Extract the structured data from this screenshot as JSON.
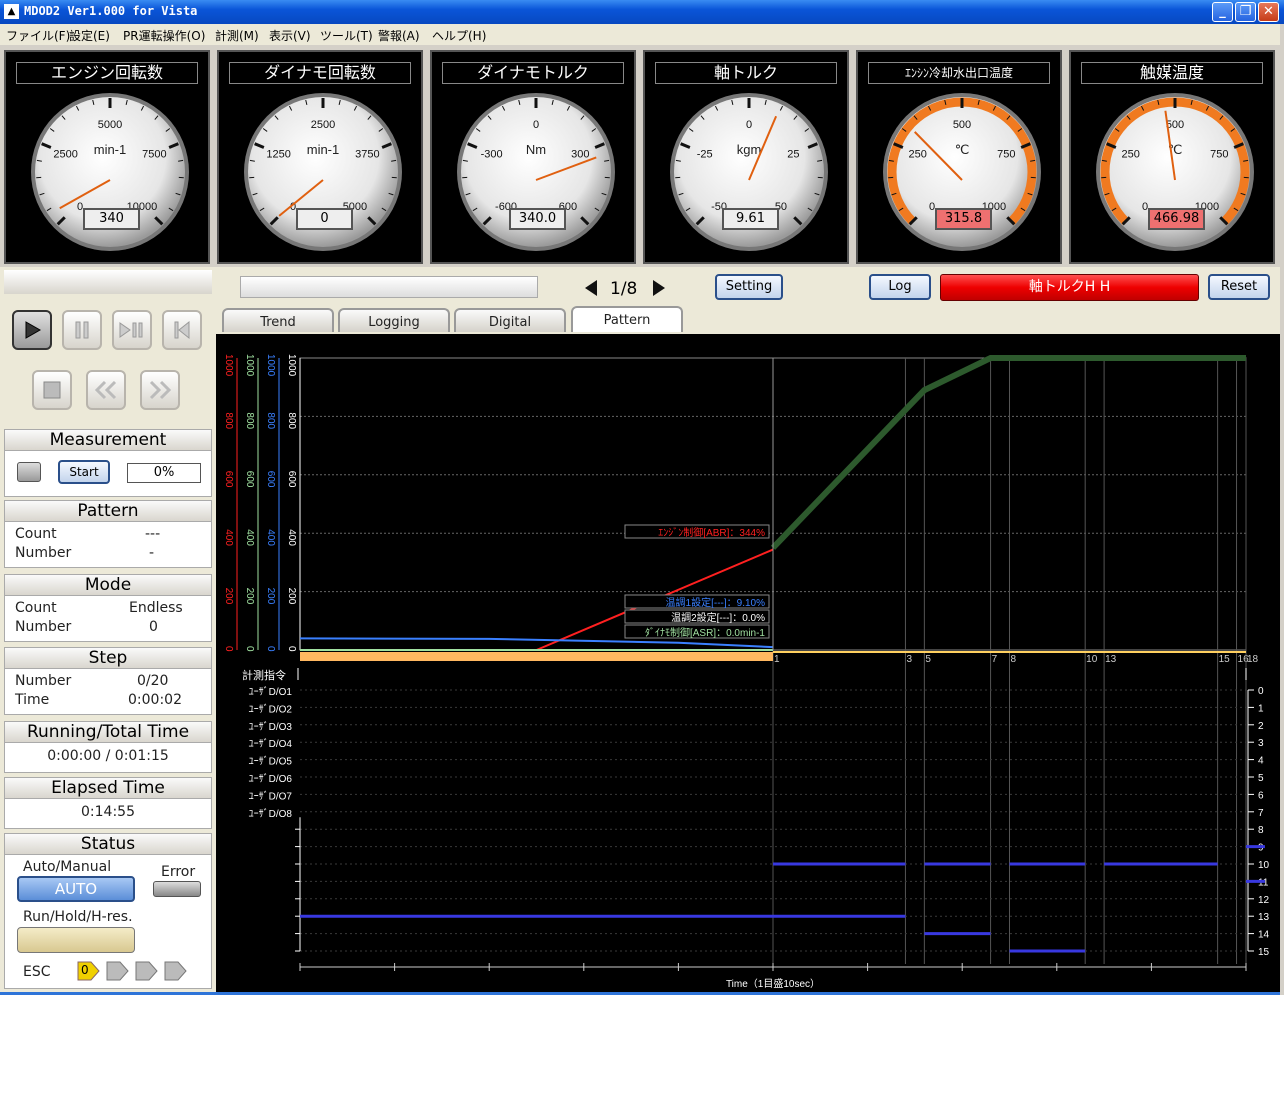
{
  "window": {
    "title": "MDOD2 Ver1.000 for Vista",
    "icon": "app-icon"
  },
  "menu": [
    "ファイル(F)",
    "設定(E)",
    "PR運転操作(O)",
    "計測(M)",
    "表示(V)",
    "ツール(T)",
    "警報(A)",
    "ヘルプ(H)"
  ],
  "gauges": [
    {
      "title": "エンジン回転数",
      "unit": "min-1",
      "ticks": [
        "0",
        "2500",
        "5000",
        "7500",
        "10000"
      ],
      "value": "340",
      "needle_fraction": 0.034,
      "warn": false
    },
    {
      "title": "ダイナモ回転数",
      "unit": "min-1",
      "ticks": [
        "0",
        "1250",
        "2500",
        "3750",
        "5000"
      ],
      "value": "0",
      "needle_fraction": 0.0,
      "warn": false
    },
    {
      "title": "ダイナモトルク",
      "unit": "Nm",
      "ticks": [
        "-600",
        "-300",
        "0",
        "300",
        "600"
      ],
      "value": "340.0",
      "needle_fraction": 0.783,
      "warn": false
    },
    {
      "title": "軸トルク",
      "unit": "kgm",
      "ticks": [
        "-50",
        "-25",
        "0",
        "25",
        "50"
      ],
      "value": "9.61",
      "needle_fraction": 0.596,
      "warn": false
    },
    {
      "title": "ｴﾝｼﾝ冷却水出口温度",
      "unit": "℃",
      "ticks": [
        "0",
        "250",
        "500",
        "750",
        "1000"
      ],
      "value": "315.8",
      "needle_fraction": 0.316,
      "warn": true
    },
    {
      "title": "触媒温度",
      "unit": "℃",
      "ticks": [
        "0",
        "250",
        "500",
        "750",
        "1000"
      ],
      "value": "466.98",
      "needle_fraction": 0.467,
      "warn": true
    }
  ],
  "controls": {
    "icons": [
      "play-icon",
      "pause-icon",
      "step-play-pause-icon",
      "skip-back-icon",
      "stop-icon",
      "rewind-icon",
      "fast-forward-icon"
    ]
  },
  "measurement": {
    "title": "Measurement",
    "start": "Start",
    "progress": "0%"
  },
  "pattern": {
    "title": "Pattern",
    "count_label": "Count",
    "count": "---",
    "number_label": "Number",
    "number": "-"
  },
  "mode": {
    "title": "Mode",
    "count_label": "Count",
    "count": "Endless",
    "number_label": "Number",
    "number": "0"
  },
  "step": {
    "title": "Step",
    "number_label": "Number",
    "number": "0/20",
    "time_label": "Time",
    "time": "0:00:02"
  },
  "running": {
    "title": "Running/Total Time",
    "value": "0:00:00 / 0:01:15"
  },
  "elapsed": {
    "title": "Elapsed Time",
    "value": "0:14:55"
  },
  "status": {
    "title": "Status",
    "auto_manual": "Auto/Manual",
    "auto": "AUTO",
    "error": "Error",
    "run_hold": "Run/Hold/H-res.",
    "esc": "ESC",
    "esc_value": "0"
  },
  "toolbar": {
    "page": "1/8",
    "setting": "Setting",
    "log": "Log",
    "alarm": "軸トルクH H",
    "reset": "Reset",
    "alarm_color": "#ee0000"
  },
  "tabs": [
    "Trend",
    "Logging",
    "Digital",
    "Pattern"
  ],
  "chart_data": {
    "type": "line",
    "y_axes": [
      {
        "color": "#ff2020",
        "ticks": [
          "1000",
          "800",
          "600",
          "400",
          "200",
          "0"
        ]
      },
      {
        "color": "#a0e0a0",
        "ticks": [
          "1000",
          "800",
          "600",
          "400",
          "200",
          "0"
        ]
      },
      {
        "color": "#3a80ff",
        "ticks": [
          "1000",
          "800",
          "600",
          "400",
          "200",
          "0"
        ]
      },
      {
        "color": "#ffffff",
        "ticks": [
          "1000",
          "800",
          "600",
          "400",
          "200",
          "0"
        ]
      }
    ],
    "ylim": [
      0,
      1000
    ],
    "xlim": [
      0,
      100
    ],
    "step_markers": [
      {
        "x": 50,
        "label": "1"
      },
      {
        "x": 64,
        "label": "3"
      },
      {
        "x": 66,
        "label": "5"
      },
      {
        "x": 73,
        "label": "7"
      },
      {
        "x": 75,
        "label": "8"
      },
      {
        "x": 83,
        "label": "10"
      },
      {
        "x": 85,
        "label": "13"
      },
      {
        "x": 97,
        "label": "15"
      },
      {
        "x": 99,
        "label": "16"
      },
      {
        "x": 100,
        "label": "18"
      }
    ],
    "series": [
      {
        "name": "ｴﾝｼﾞﾝ制御[ABR]：344%",
        "color": "#ff2020",
        "points": [
          [
            25,
            0
          ],
          [
            50,
            344
          ]
        ]
      },
      {
        "name": "温調1設定[---]：9.10%",
        "color": "#3a80ff",
        "points": [
          [
            0,
            40
          ],
          [
            20,
            38
          ],
          [
            40,
            25
          ],
          [
            50,
            10
          ]
        ]
      },
      {
        "name": "温調2設定[---]：0.0%",
        "color": "#ffffff",
        "points": [
          [
            0,
            0
          ],
          [
            50,
            0
          ]
        ]
      },
      {
        "name": "ﾀﾞｲﾅﾓ制御[ASR]：0.0min-1",
        "color": "#a0e0a0",
        "points": [
          [
            0,
            0
          ],
          [
            50,
            0
          ]
        ]
      },
      {
        "color": "#2d5a2d",
        "points": [
          [
            50,
            350
          ],
          [
            66,
            890
          ],
          [
            73,
            1000
          ],
          [
            100,
            1000
          ]
        ]
      }
    ],
    "do_label": "計測指令",
    "do_rows": [
      "ﾕｰｻﾞD/O1",
      "ﾕｰｻﾞD/O2",
      "ﾕｰｻﾞD/O3",
      "ﾕｰｻﾞD/O4",
      "ﾕｰｻﾞD/O5",
      "ﾕｰｻﾞD/O6",
      "ﾕｰｻﾞD/O7",
      "ﾕｰｻﾞD/O8"
    ],
    "right_ticks": [
      "0",
      "1",
      "2",
      "3",
      "4",
      "5",
      "6",
      "7",
      "8",
      "9",
      "10",
      "11",
      "12",
      "13",
      "14",
      "15"
    ],
    "step_bars": [
      {
        "row": 13,
        "from": 0,
        "to": 64
      },
      {
        "row": 10,
        "from": 50,
        "to": 64
      },
      {
        "row": 10,
        "from": 66,
        "to": 73
      },
      {
        "row": 14,
        "from": 66,
        "to": 73
      },
      {
        "row": 10,
        "from": 75,
        "to": 83
      },
      {
        "row": 15,
        "from": 75,
        "to": 83
      },
      {
        "row": 10,
        "from": 85,
        "to": 97
      },
      {
        "row": 9,
        "from": 100,
        "to": 102
      },
      {
        "row": 11,
        "from": 100,
        "to": 102
      }
    ],
    "xlabel": "Time（1目盛10sec）"
  }
}
